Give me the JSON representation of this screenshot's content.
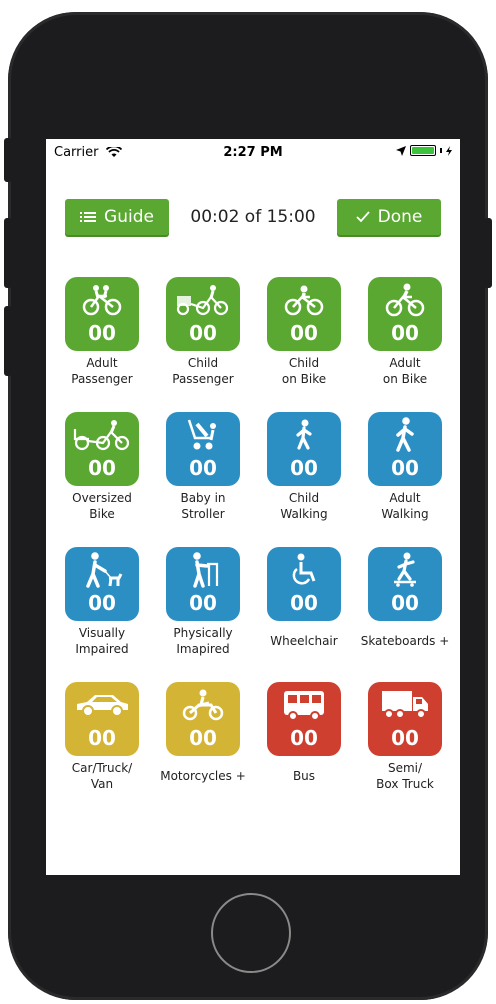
{
  "status_bar": {
    "carrier": "Carrier",
    "time": "2:27 PM"
  },
  "toolbar": {
    "guide_label": "Guide",
    "timer": "00:02 of 15:00",
    "done_label": "Done"
  },
  "colors": {
    "green": "#5aa832",
    "blue": "#2c8fc4",
    "yellow": "#d4b434",
    "red": "#cf3f2f"
  },
  "tiles": [
    {
      "label": "Adult\nPassenger",
      "count": "00",
      "icon": "tandem-bike-icon"
    },
    {
      "label": "Child\nPassenger",
      "count": "00",
      "icon": "bike-trailer-icon"
    },
    {
      "label": "Child\non Bike",
      "count": "00",
      "icon": "child-bike-icon"
    },
    {
      "label": "Adult\non Bike",
      "count": "00",
      "icon": "adult-bike-icon"
    },
    {
      "label": "Oversized\nBike",
      "count": "00",
      "icon": "cargo-bike-icon"
    },
    {
      "label": "Baby in\nStroller",
      "count": "00",
      "icon": "stroller-icon"
    },
    {
      "label": "Child\nWalking",
      "count": "00",
      "icon": "child-walking-icon"
    },
    {
      "label": "Adult\nWalking",
      "count": "00",
      "icon": "adult-walking-icon"
    },
    {
      "label": "Visually\nImpaired",
      "count": "00",
      "icon": "guide-dog-icon"
    },
    {
      "label": "Physically\nImapired",
      "count": "00",
      "icon": "walker-icon"
    },
    {
      "label": "Wheelchair",
      "count": "00",
      "icon": "wheelchair-icon"
    },
    {
      "label": "Skateboards +",
      "count": "00",
      "icon": "skateboard-icon"
    },
    {
      "label": "Car/Truck/\nVan",
      "count": "00",
      "icon": "car-icon"
    },
    {
      "label": "Motorcycles +",
      "count": "00",
      "icon": "motorcycle-icon"
    },
    {
      "label": "Bus",
      "count": "00",
      "icon": "bus-icon"
    },
    {
      "label": "Semi/\nBox Truck",
      "count": "00",
      "icon": "truck-icon"
    }
  ]
}
